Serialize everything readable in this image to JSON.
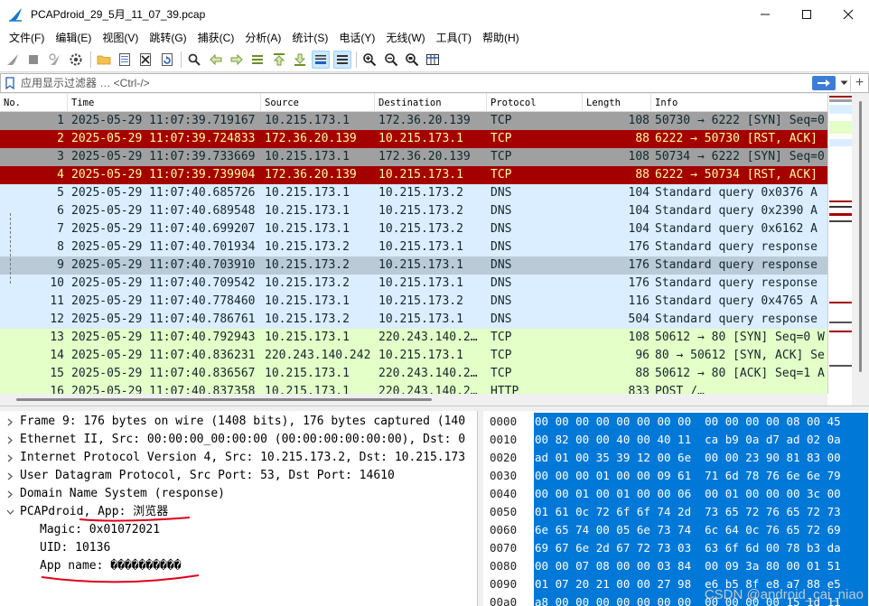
{
  "window": {
    "title": "PCAPdroid_29_5月_11_07_39.pcap",
    "min_label": "—",
    "max_label": "☐",
    "close_label": "✕"
  },
  "menu": [
    "文件(F)",
    "编辑(E)",
    "视图(V)",
    "跳转(G)",
    "捕获(C)",
    "分析(A)",
    "统计(S)",
    "电话(Y)",
    "无线(W)",
    "工具(T)",
    "帮助(H)"
  ],
  "toolbar": {
    "icons": [
      "shark-fin-start-icon",
      "stop-square-icon",
      "restart-fin-icon",
      "capture-options-gear-icon",
      "open-folder-icon",
      "save-file-icon",
      "close-file-icon",
      "reload-file-icon",
      "find-packet-icon",
      "go-back-icon",
      "go-forward-icon",
      "go-to-packet-icon",
      "go-first-icon",
      "go-last-icon",
      "auto-scroll-icon",
      "colorize-icon",
      "zoom-in-icon",
      "zoom-out-icon",
      "zoom-normal-icon",
      "resize-columns-icon"
    ]
  },
  "filter": {
    "placeholder": "应用显示过滤器 … <Ctrl-/>",
    "plus_label": "+"
  },
  "packet_list": {
    "columns": [
      "No.",
      "Time",
      "Source",
      "Destination",
      "Protocol",
      "Length",
      "Info"
    ],
    "rows": [
      {
        "no": "1",
        "time": "2025-05-29 11:07:39.719167",
        "src": "10.215.173.1",
        "dst": "172.36.20.139",
        "proto": "TCP",
        "len": "108",
        "info": "50730 → 6222 [SYN] Seq=0",
        "style": "gray"
      },
      {
        "no": "2",
        "time": "2025-05-29 11:07:39.724833",
        "src": "172.36.20.139",
        "dst": "10.215.173.1",
        "proto": "TCP",
        "len": "88",
        "info": "6222 → 50730 [RST, ACK]",
        "style": "red"
      },
      {
        "no": "3",
        "time": "2025-05-29 11:07:39.733669",
        "src": "10.215.173.1",
        "dst": "172.36.20.139",
        "proto": "TCP",
        "len": "108",
        "info": "50734 → 6222 [SYN] Seq=0",
        "style": "gray"
      },
      {
        "no": "4",
        "time": "2025-05-29 11:07:39.739904",
        "src": "172.36.20.139",
        "dst": "10.215.173.1",
        "proto": "TCP",
        "len": "88",
        "info": "6222 → 50734 [RST, ACK]",
        "style": "red"
      },
      {
        "no": "5",
        "time": "2025-05-29 11:07:40.685726",
        "src": "10.215.173.1",
        "dst": "10.215.173.2",
        "proto": "DNS",
        "len": "104",
        "info": "Standard query 0x0376 A",
        "style": "blue"
      },
      {
        "no": "6",
        "time": "2025-05-29 11:07:40.689548",
        "src": "10.215.173.1",
        "dst": "10.215.173.2",
        "proto": "DNS",
        "len": "104",
        "info": "Standard query 0x2390 A",
        "style": "blue"
      },
      {
        "no": "7",
        "time": "2025-05-29 11:07:40.699207",
        "src": "10.215.173.1",
        "dst": "10.215.173.2",
        "proto": "DNS",
        "len": "104",
        "info": "Standard query 0x6162 A",
        "style": "blue"
      },
      {
        "no": "8",
        "time": "2025-05-29 11:07:40.701934",
        "src": "10.215.173.2",
        "dst": "10.215.173.1",
        "proto": "DNS",
        "len": "176",
        "info": "Standard query response",
        "style": "blue"
      },
      {
        "no": "9",
        "time": "2025-05-29 11:07:40.703910",
        "src": "10.215.173.2",
        "dst": "10.215.173.1",
        "proto": "DNS",
        "len": "176",
        "info": "Standard query response",
        "style": "selected"
      },
      {
        "no": "10",
        "time": "2025-05-29 11:07:40.709542",
        "src": "10.215.173.2",
        "dst": "10.215.173.1",
        "proto": "DNS",
        "len": "176",
        "info": "Standard query response",
        "style": "blue"
      },
      {
        "no": "11",
        "time": "2025-05-29 11:07:40.778460",
        "src": "10.215.173.1",
        "dst": "10.215.173.2",
        "proto": "DNS",
        "len": "116",
        "info": "Standard query 0x4765 A",
        "style": "blue"
      },
      {
        "no": "12",
        "time": "2025-05-29 11:07:40.786761",
        "src": "10.215.173.2",
        "dst": "10.215.173.1",
        "proto": "DNS",
        "len": "504",
        "info": "Standard query response",
        "style": "blue"
      },
      {
        "no": "13",
        "time": "2025-05-29 11:07:40.792943",
        "src": "10.215.173.1",
        "dst": "220.243.140.2…",
        "proto": "TCP",
        "len": "108",
        "info": "50612 → 80 [SYN] Seq=0 W",
        "style": "lgreen"
      },
      {
        "no": "14",
        "time": "2025-05-29 11:07:40.836231",
        "src": "220.243.140.242",
        "dst": "10.215.173.1",
        "proto": "TCP",
        "len": "96",
        "info": "80 → 50612 [SYN, ACK] Se",
        "style": "lgreen"
      },
      {
        "no": "15",
        "time": "2025-05-29 11:07:40.836567",
        "src": "10.215.173.1",
        "dst": "220.243.140.2…",
        "proto": "TCP",
        "len": "88",
        "info": "50612 → 80 [ACK] Seq=1 A",
        "style": "lgreen"
      },
      {
        "no": "16",
        "time": "2025-05-29 11:07:40.837358",
        "src": "10.215.173.1",
        "dst": "220.243.140.2…",
        "proto": "HTTP",
        "len": "833",
        "info": "POST /…",
        "style": "lgreen"
      }
    ]
  },
  "details": {
    "items": [
      {
        "text": "Frame 9: 176 bytes on wire (1408 bits), 176 bytes captured (140",
        "expanded": false
      },
      {
        "text": "Ethernet II, Src: 00:00:00_00:00:00 (00:00:00:00:00:00), Dst: 0",
        "expanded": false
      },
      {
        "text": "Internet Protocol Version 4, Src: 10.215.173.2, Dst: 10.215.173",
        "expanded": false
      },
      {
        "text": "User Datagram Protocol, Src Port: 53, Dst Port: 14610",
        "expanded": false
      },
      {
        "text": "Domain Name System (response)",
        "expanded": false
      },
      {
        "text": "PCAPdroid, App: 浏览器",
        "expanded": true
      }
    ],
    "children": [
      "Magic: 0x01072021",
      "UID: 10136",
      "App name: ����������"
    ]
  },
  "bytes": {
    "rows": [
      {
        "off": "0000",
        "hex": "00 00 00 00 00 00 00 00  00 00 00 00 08 00 45"
      },
      {
        "off": "0010",
        "hex": "00 82 00 00 40 00 40 11  ca b9 0a d7 ad 02 0a"
      },
      {
        "off": "0020",
        "hex": "ad 01 00 35 39 12 00 6e  00 00 23 90 81 83 00"
      },
      {
        "off": "0030",
        "hex": "00 00 00 01 00 00 09 61  71 6d 78 76 6e 6e 79"
      },
      {
        "off": "0040",
        "hex": "00 00 01 00 01 00 00 06  00 01 00 00 00 3c 00"
      },
      {
        "off": "0050",
        "hex": "01 61 0c 72 6f 6f 74 2d  73 65 72 76 65 72 73"
      },
      {
        "off": "0060",
        "hex": "6e 65 74 00 05 6e 73 74  6c 64 0c 76 65 72 69"
      },
      {
        "off": "0070",
        "hex": "69 67 6e 2d 67 72 73 03  63 6f 6d 00 78 b3 da"
      },
      {
        "off": "0080",
        "hex": "00 00 07 08 00 00 03 84  00 09 3a 80 00 01 51"
      },
      {
        "off": "0090",
        "hex": "01 07 20 21 00 00 27 98  e6 b5 8f e8 a7 88 e5"
      },
      {
        "off": "00a0",
        "hex": "a8 00 00 00 00 00 00 00  00 00 00 00 15 1d 11"
      }
    ],
    "watermark": "CSDN @android_cai_niao"
  },
  "colors": {
    "gray_row": "#a0a0a0",
    "red_row": "#a40000",
    "red_row_text": "#fffc9c",
    "blue_row": "#daeeff",
    "green_row": "#e4ffc7",
    "selected_row": "#bacbd7",
    "hex_highlight": "#0078d7",
    "annotation_red": "#e0001b"
  }
}
